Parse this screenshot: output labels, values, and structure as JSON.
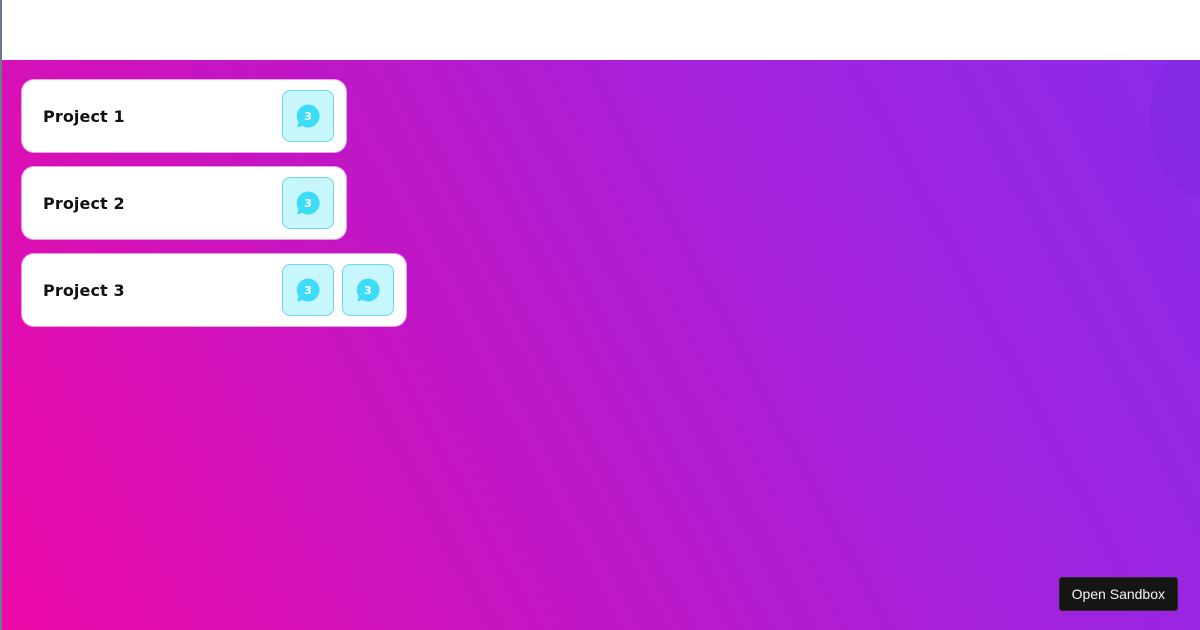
{
  "projects": [
    {
      "title": "Project 1",
      "badges": [
        {
          "icon": "chat-bubble-icon",
          "count": "3"
        }
      ]
    },
    {
      "title": "Project 2",
      "badges": [
        {
          "icon": "chat-bubble-icon",
          "count": "3"
        }
      ]
    },
    {
      "title": "Project 3",
      "badges": [
        {
          "icon": "chat-bubble-icon",
          "count": "3"
        },
        {
          "icon": "chat-bubble-icon",
          "count": "3"
        }
      ]
    }
  ],
  "sandbox": {
    "button_label": "Open Sandbox"
  },
  "colors": {
    "gradient_start": "#ee0aa8",
    "gradient_end": "#8a2bea",
    "badge_bg": "#c8f6fd",
    "badge_icon": "#3ddcf7",
    "button_bg": "#151515"
  }
}
